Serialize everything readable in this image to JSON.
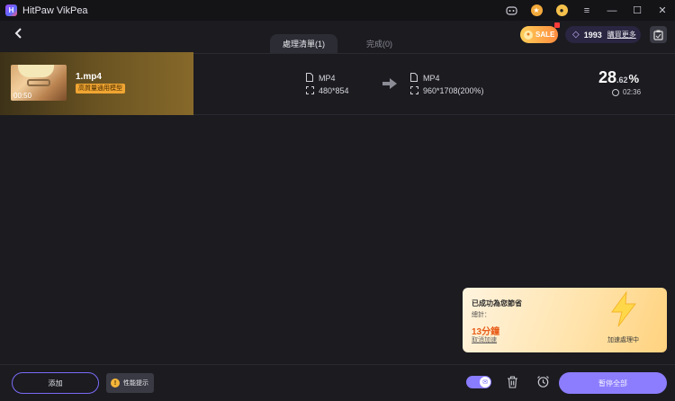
{
  "app": {
    "title": "HitPaw VikPea"
  },
  "titlebar": {
    "icons": [
      "discord-icon",
      "coin-icon",
      "user-icon",
      "menu-icon",
      "minimize-icon",
      "maximize-icon",
      "close-icon"
    ]
  },
  "tabs": [
    {
      "label": "處理清單(1)",
      "active": true
    },
    {
      "label": "完成(0)",
      "active": false
    }
  ],
  "promo": {
    "sale_label": "SALE"
  },
  "credits": {
    "amount": "1993",
    "buy_label": "購買更多"
  },
  "task": {
    "duration": "00:50",
    "filename": "1.mp4",
    "model": "高質量通用模型",
    "source": {
      "format": "MP4",
      "resolution": "480*854"
    },
    "output": {
      "format": "MP4",
      "resolution": "960*1708(200%)"
    },
    "progress_int": "28",
    "progress_dec": ".62",
    "progress_sign": "%",
    "progress_value": 28.62,
    "remaining": "02:36"
  },
  "card": {
    "title": "已成功為您節省",
    "total_label": "總計：",
    "minutes": "13分鐘",
    "cancel_label": "取消加速",
    "status": "加速處理中"
  },
  "footer": {
    "add_label": "添加",
    "tip_label": "性能提示",
    "pause_all_label": "暫停全部"
  },
  "colors": {
    "accent": "#8c7dff",
    "warning": "#f0a532",
    "highlight": "#e85d1a"
  }
}
